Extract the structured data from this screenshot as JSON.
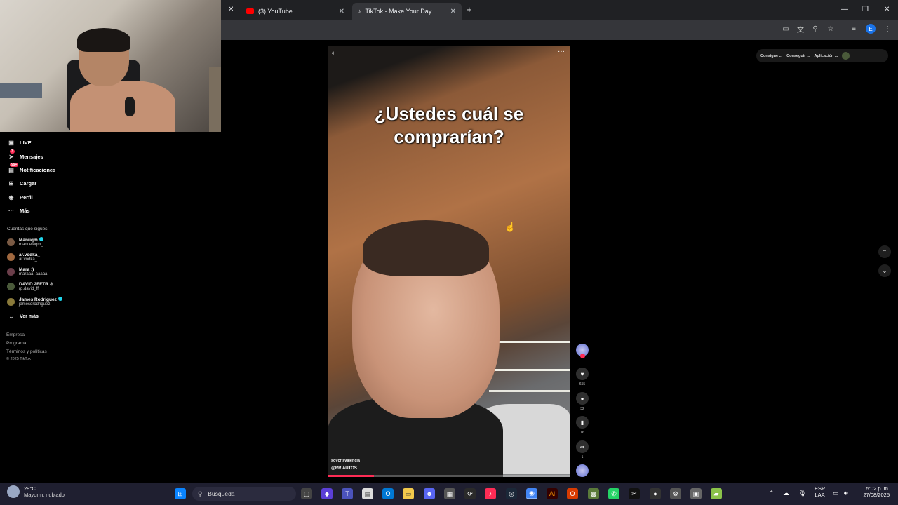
{
  "browser": {
    "tabs": [
      {
        "label": "(3) YouTube",
        "icon": "youtube-icon",
        "active": false
      },
      {
        "label": "TikTok - Make Your Day",
        "icon": "tiktok-icon",
        "active": true
      }
    ],
    "new_tab": "+",
    "win_controls": [
      "—",
      "❐",
      "✕"
    ]
  },
  "sidebar": {
    "nav": [
      {
        "label": "LIVE",
        "icon": "live-icon"
      },
      {
        "label": "Mensajes",
        "icon": "messages-icon",
        "badge": "3"
      },
      {
        "label": "Notificaciones",
        "icon": "notifications-icon",
        "badge": "99+"
      },
      {
        "label": "Cargar",
        "icon": "upload-icon"
      },
      {
        "label": "Perfil",
        "icon": "profile-icon"
      },
      {
        "label": "Más",
        "icon": "more-icon"
      }
    ],
    "following_title": "Cuentas que sigues",
    "accounts": [
      {
        "name": "Manuqm",
        "handle": "manuelaqm_",
        "verified": true
      },
      {
        "name": "ar.vodka_",
        "handle": "ar.vodka_",
        "verified": false
      },
      {
        "name": "Mara :)",
        "handle": "maraaa_aaaaa",
        "verified": false
      },
      {
        "name": "DAVID 2FFTR ♨",
        "handle": "rp.david_ff",
        "verified": false
      },
      {
        "name": "James Rodriguez",
        "handle": "jamesdrodriguez",
        "verified": true
      }
    ],
    "see_more": "Ver más",
    "footer": [
      "Empresa",
      "Programa",
      "Términos y políticas",
      "© 2025 TikTok"
    ]
  },
  "video": {
    "caption": "¿Ustedes cuál se comprarían?",
    "username": "soycrisvalencia_",
    "tag": "@RR AUTOS",
    "progress": 0.19
  },
  "actions": [
    {
      "name": "like",
      "icon": "heart-icon",
      "count": "655"
    },
    {
      "name": "comment",
      "icon": "comment-icon",
      "count": "32"
    },
    {
      "name": "save",
      "icon": "bookmark-icon",
      "count": "16"
    },
    {
      "name": "share",
      "icon": "share-icon",
      "count": "1"
    }
  ],
  "extensions": [
    "Consigue ...",
    "Conseguir ...",
    "Aplicación ..."
  ],
  "taskbar": {
    "temp": "29°C",
    "weather": "Mayorm. nublado",
    "search": "Búsqueda",
    "lang1": "ESP",
    "lang2": "LAA",
    "time": "5:02 p. m.",
    "date": "27/08/2025"
  }
}
